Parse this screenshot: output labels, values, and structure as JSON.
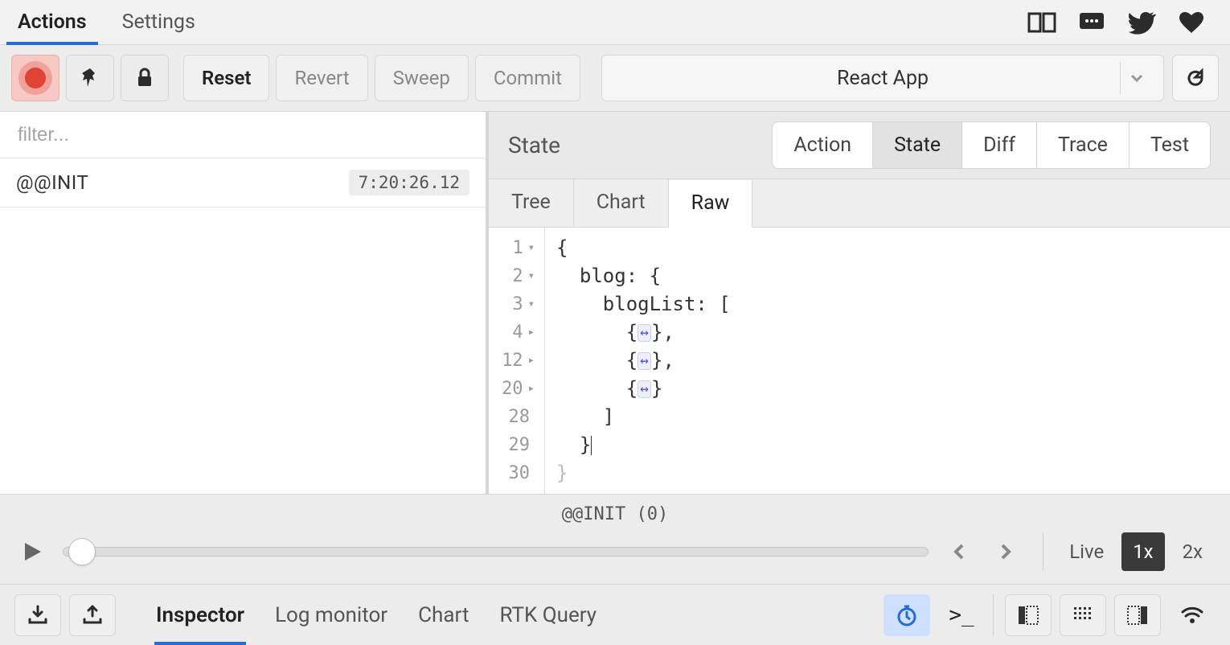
{
  "topnav": {
    "tabs": [
      {
        "label": "Actions",
        "active": true
      },
      {
        "label": "Settings",
        "active": false
      }
    ]
  },
  "toolbar": {
    "reset": "Reset",
    "revert": "Revert",
    "sweep": "Sweep",
    "commit": "Commit",
    "app_name": "React App"
  },
  "filter": {
    "placeholder": "filter..."
  },
  "actions": [
    {
      "name": "@@INIT",
      "time": "7:20:26.12"
    }
  ],
  "state_header": {
    "title": "State",
    "views": [
      {
        "label": "Action",
        "active": false
      },
      {
        "label": "State",
        "active": true
      },
      {
        "label": "Diff",
        "active": false
      },
      {
        "label": "Trace",
        "active": false
      },
      {
        "label": "Test",
        "active": false
      }
    ],
    "sub": [
      {
        "label": "Tree",
        "active": false
      },
      {
        "label": "Chart",
        "active": false
      },
      {
        "label": "Raw",
        "active": true
      }
    ]
  },
  "code": {
    "lines": [
      {
        "num": "1",
        "fold": "▾",
        "text": "{"
      },
      {
        "num": "2",
        "fold": "▾",
        "text": "  blog: {"
      },
      {
        "num": "3",
        "fold": "▾",
        "text": "    blogList: ["
      },
      {
        "num": "4",
        "fold": "▸",
        "text": "      {↔},"
      },
      {
        "num": "12",
        "fold": "▸",
        "text": "      {↔},"
      },
      {
        "num": "20",
        "fold": "▸",
        "text": "      {↔}"
      },
      {
        "num": "28",
        "fold": "",
        "text": "    ]"
      },
      {
        "num": "29",
        "fold": "",
        "text": "  }|"
      },
      {
        "num": "30",
        "fold": "",
        "text": "}"
      }
    ]
  },
  "player": {
    "current": "@@INIT (0)",
    "speeds": [
      {
        "label": "Live",
        "active": false
      },
      {
        "label": "1x",
        "active": true
      },
      {
        "label": "2x",
        "active": false
      }
    ]
  },
  "bottom": {
    "monitors": [
      {
        "label": "Inspector",
        "active": true
      },
      {
        "label": "Log monitor",
        "active": false
      },
      {
        "label": "Chart",
        "active": false
      },
      {
        "label": "RTK Query",
        "active": false
      }
    ]
  }
}
